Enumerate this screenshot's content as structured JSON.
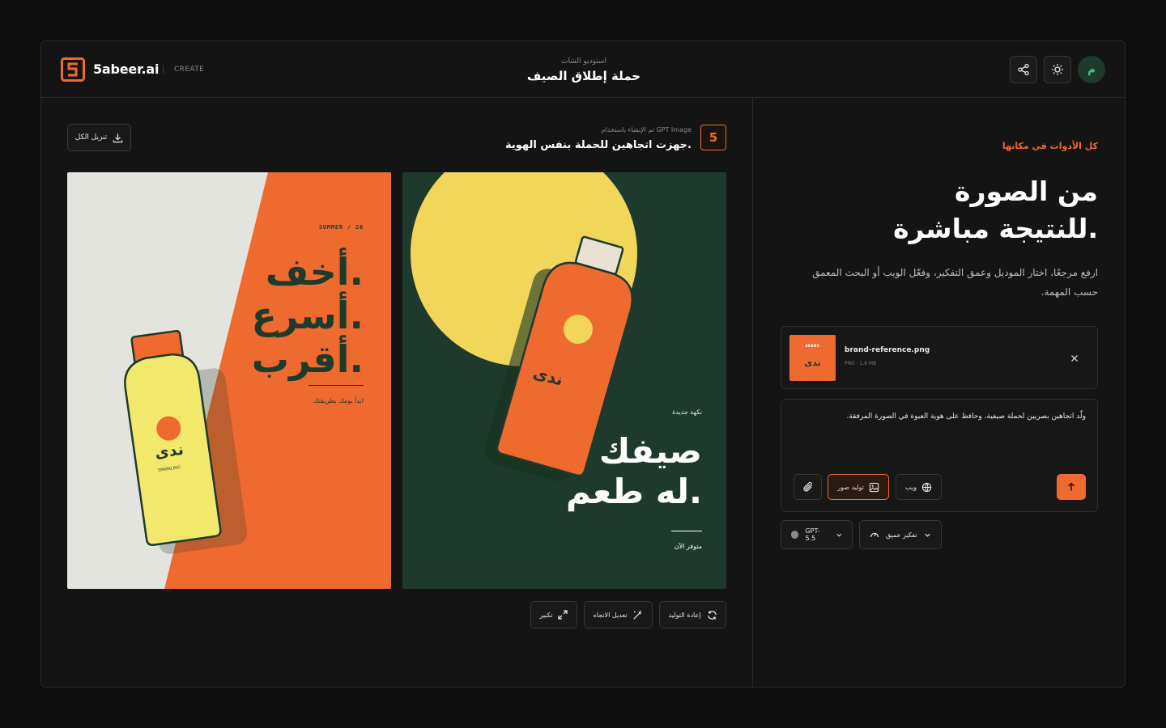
{
  "header": {
    "brand_name": "5abeer.ai",
    "brand_mode": "CREATE",
    "subtitle": "استوديو الشات",
    "title": "حملة إطلاق الصيف",
    "share_icon": "share-icon",
    "theme_icon": "sun-icon",
    "avatar_initial": "م"
  },
  "generation": {
    "meta": "تم الإنشاء باستخدام GPT Image",
    "title": "جهزت اتجاهين للحملة بنفس الهوية.",
    "badge": "5",
    "download_all": "تنزيل الكل"
  },
  "cards": [
    {
      "season": "SUMMER / 26",
      "headline": [
        "أخف.",
        "أسرع.",
        "أقرب."
      ],
      "tagline": "ابدأ يومك بطريقتك",
      "bottle_label": "ندى",
      "bottle_sub": "SPARKLING"
    },
    {
      "kicker": "نكهة جديدة",
      "headline": [
        "صيفك",
        "له طعم."
      ],
      "tagline": "متوفر الآن",
      "bottle_label": "ندى"
    }
  ],
  "actions": {
    "regenerate": "إعادة التوليد",
    "edit_direction": "تعديل الاتجاه",
    "upscale": "تكبير"
  },
  "panel": {
    "eyebrow": "كل الأدوات في مكانها",
    "title_lines": [
      "من الصورة",
      "للنتيجة مباشرة."
    ],
    "description": "ارفع مرجعًا، اختار الموديل وعمق التفكير، وفعّل الويب أو البحث المعمق حسب المهمة."
  },
  "attachment": {
    "file_name": "brand-reference.png",
    "file_meta": "PNG · 1.8 MB",
    "thumb_brand": "BRAND",
    "thumb_label": "ندى"
  },
  "composer": {
    "prompt": "ولّد اتجاهين بصريين لحملة صيفية، وحافظ على هوية العبوة في الصورة المرفقة.",
    "image_gen_label": "توليد صور",
    "web_label": "ويب"
  },
  "selectors": {
    "model": "GPT-5.5",
    "thinking": "تفكير عميق"
  },
  "colors": {
    "accent": "#ee6a2f",
    "brand_green": "#1e3a2c",
    "sun_yellow": "#f1d65a",
    "avatar_green": "#35d07f"
  }
}
